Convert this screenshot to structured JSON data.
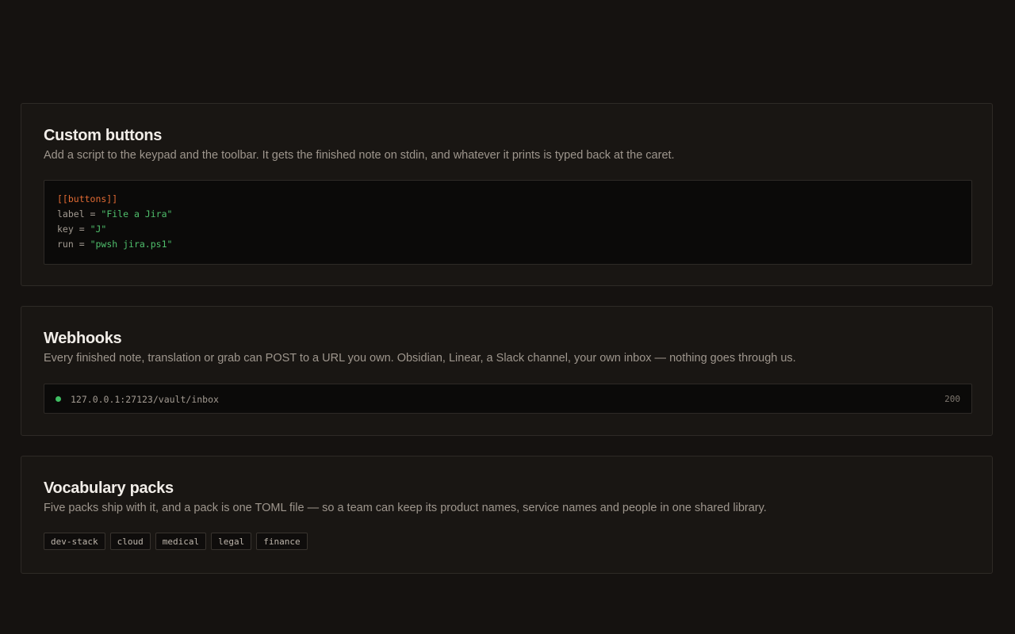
{
  "custom_buttons": {
    "title": "Custom buttons",
    "description": "Add a script to the keypad and the toolbar. It gets the finished note on stdin, and whatever it prints is typed back at the caret.",
    "code": {
      "header": "[[buttons]]",
      "lines": [
        {
          "key": "label",
          "op": " = ",
          "value": "\"File a Jira\""
        },
        {
          "key": "key",
          "op": " = ",
          "value": "\"J\""
        },
        {
          "key": "run",
          "op": " = ",
          "value": "\"pwsh jira.ps1\""
        }
      ]
    }
  },
  "webhooks": {
    "title": "Webhooks",
    "description": "Every finished note, translation or grab can POST to a URL you own. Obsidian, Linear, a Slack channel, your own inbox — nothing goes through us.",
    "endpoint": {
      "url": "127.0.0.1:27123/vault/inbox",
      "status": "200",
      "status_color": "#3fbe63"
    }
  },
  "vocabulary_packs": {
    "title": "Vocabulary packs",
    "description": "Five packs ship with it, and a pack is one TOML file — so a team can keep its product names, service names and people in one shared library.",
    "packs": [
      "dev-stack",
      "cloud",
      "medical",
      "legal",
      "finance"
    ]
  }
}
